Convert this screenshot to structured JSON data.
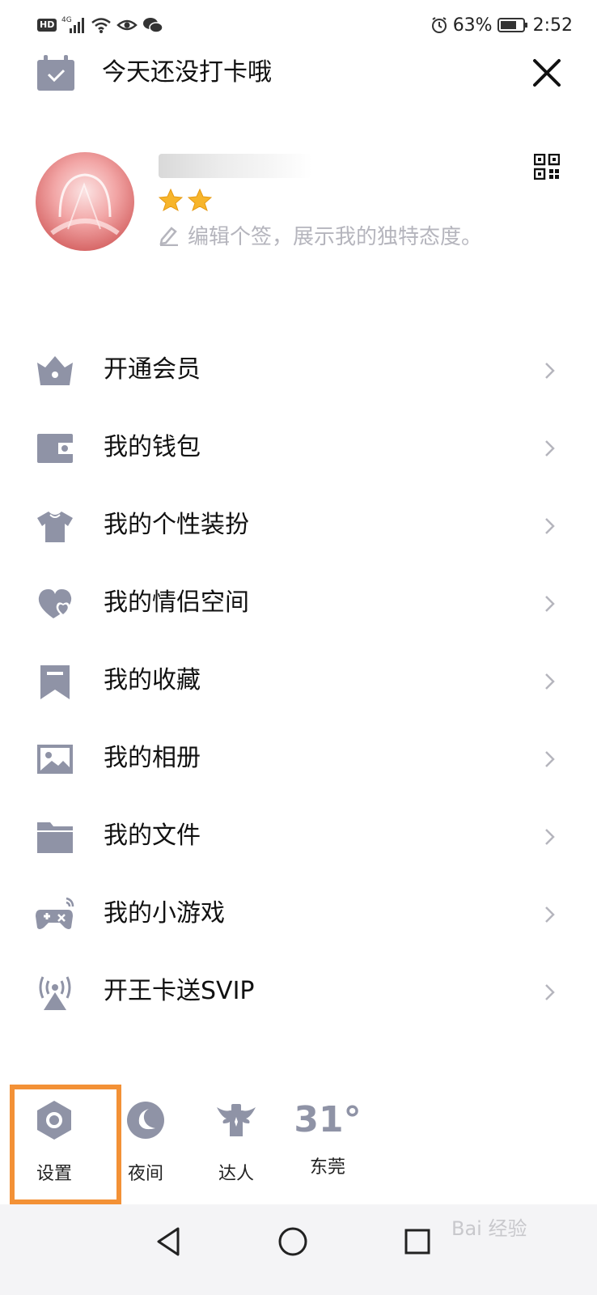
{
  "status_bar": {
    "left_badge": "HD",
    "signal_label": "4G",
    "battery_percent": "63%",
    "time": "2:52"
  },
  "header": {
    "checkin_text": "今天还没打卡哦"
  },
  "profile": {
    "signature_placeholder": "编辑个签，展示我的独特态度。"
  },
  "menu": {
    "items": [
      {
        "label": "开通会员",
        "icon": "crown-icon"
      },
      {
        "label": "我的钱包",
        "icon": "wallet-icon"
      },
      {
        "label": "我的个性装扮",
        "icon": "tshirt-icon"
      },
      {
        "label": "我的情侣空间",
        "icon": "hearts-icon"
      },
      {
        "label": "我的收藏",
        "icon": "bookmark-icon"
      },
      {
        "label": "我的相册",
        "icon": "photo-icon"
      },
      {
        "label": "我的文件",
        "icon": "folder-icon"
      },
      {
        "label": "我的小游戏",
        "icon": "gamepad-icon"
      },
      {
        "label": "开王卡送SVIP",
        "icon": "broadcast-tower-icon"
      }
    ]
  },
  "toolbar": {
    "settings_label": "设置",
    "night_label": "夜间",
    "expert_label": "达人",
    "weather_temp": "31°",
    "weather_city": "东莞"
  },
  "colors": {
    "icon_gray": "#8f93a6",
    "highlight": "#f39136"
  },
  "watermark": "Bai 经验"
}
